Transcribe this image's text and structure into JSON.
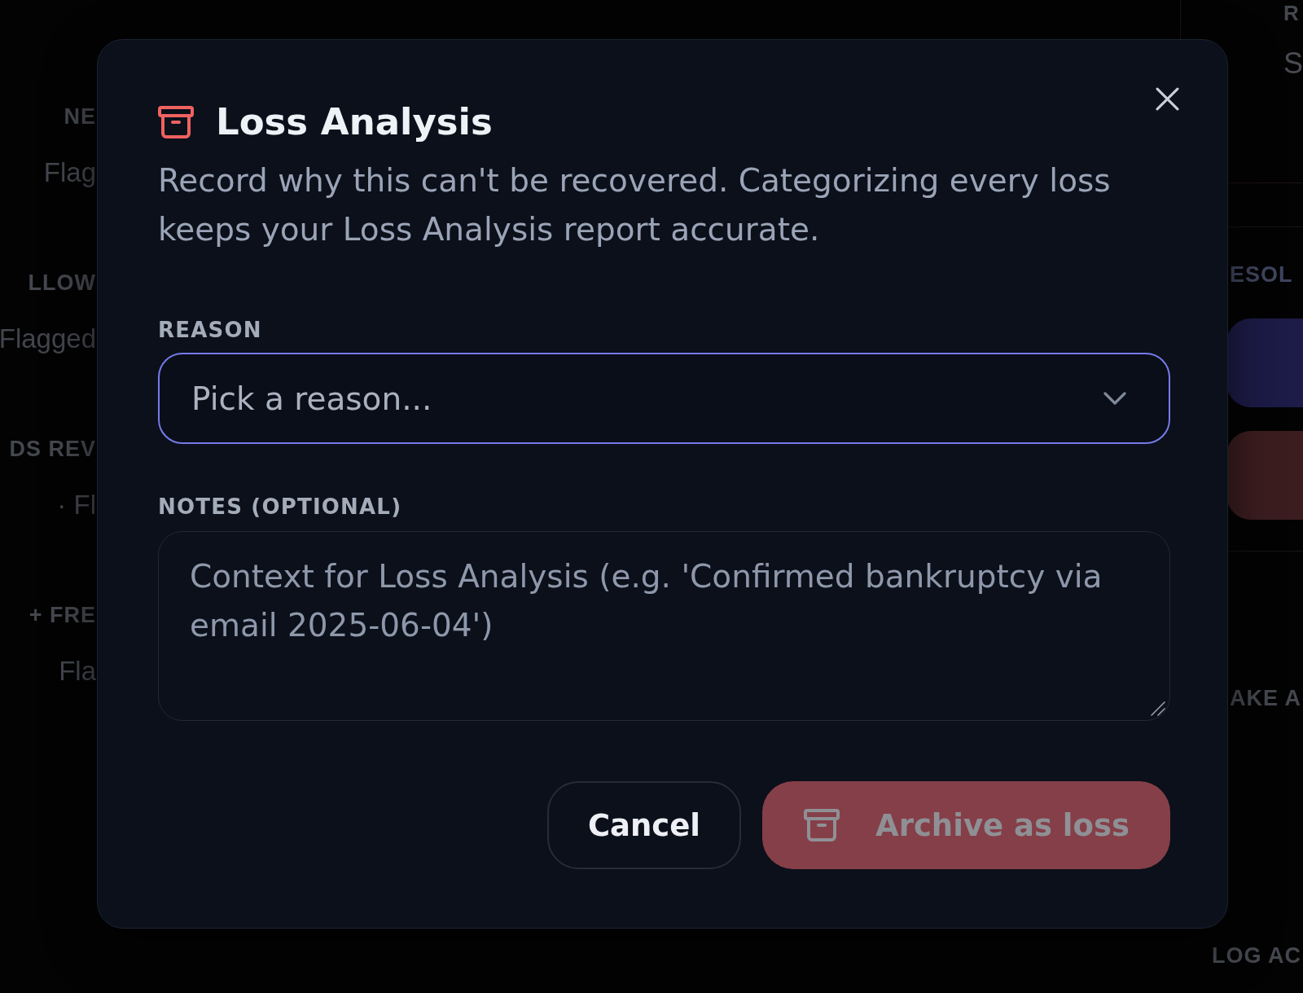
{
  "background": {
    "left_sections": [
      {
        "heading": "NE",
        "item": "Flag"
      },
      {
        "heading": "LLOW",
        "item": "Flagged"
      },
      {
        "heading": "DS REV",
        "item": "· Fl"
      },
      {
        "heading": "+ FRE",
        "item": "Fla"
      }
    ],
    "right_panel": {
      "label": "R",
      "value": "S",
      "heading": "ESOL",
      "buttons": [
        {
          "color": "#1d1b47"
        },
        {
          "color": "#3b1d1f"
        }
      ],
      "sections": [
        "AKE A",
        "LOG AC"
      ]
    }
  },
  "dialog": {
    "title": "Loss Analysis",
    "description": "Record why this can't be recovered. Categorizing every loss keeps your Loss Analysis report accurate.",
    "fields": [
      {
        "kind": "select",
        "label": "REASON",
        "placeholder": "Pick a reason...",
        "focused": true
      },
      {
        "kind": "textarea",
        "label": "NOTES (OPTIONAL)",
        "placeholder": "Context for Loss Analysis (e.g. 'Confirmed bankruptcy via email 2025-06-04')",
        "focused": false
      }
    ],
    "actions": [
      {
        "kind": "secondary",
        "label": "Cancel",
        "disabled": false
      },
      {
        "kind": "danger",
        "label": "Archive as loss",
        "disabled": true
      }
    ]
  }
}
